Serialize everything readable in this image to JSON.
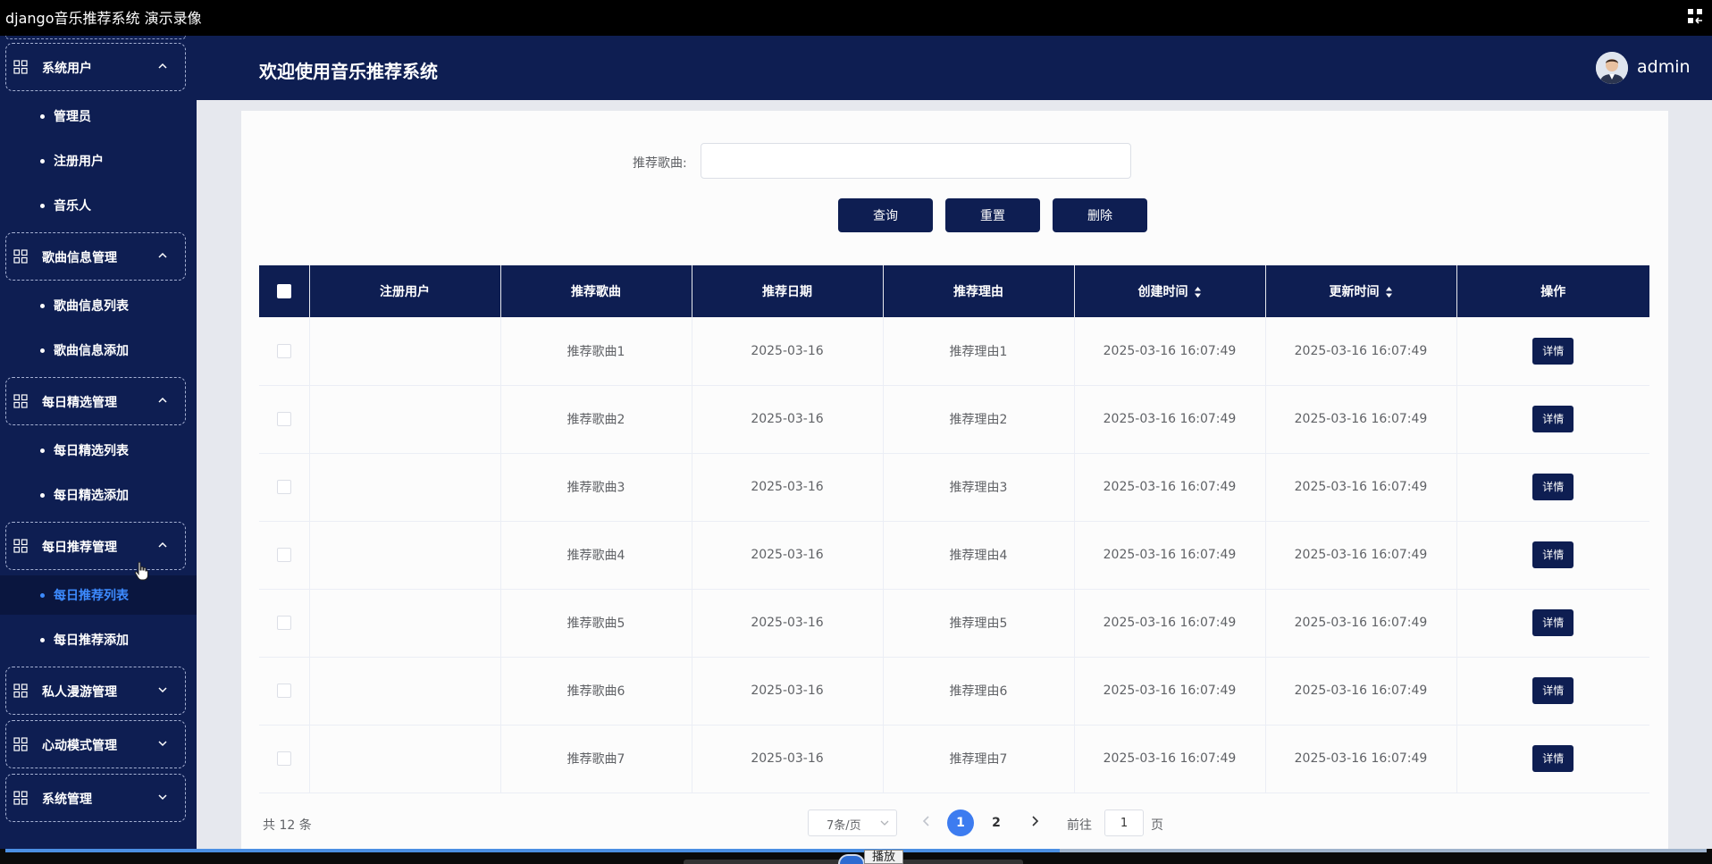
{
  "window": {
    "title": "django音乐推荐系统 演示录像"
  },
  "header": {
    "welcome": "欢迎使用音乐推荐系统",
    "username": "admin"
  },
  "sidebar": {
    "groups": [
      {
        "label": "系统用户",
        "expanded": true,
        "items": [
          "管理员",
          "注册用户",
          "音乐人"
        ]
      },
      {
        "label": "歌曲信息管理",
        "expanded": true,
        "items": [
          "歌曲信息列表",
          "歌曲信息添加"
        ]
      },
      {
        "label": "每日精选管理",
        "expanded": true,
        "items": [
          "每日精选列表",
          "每日精选添加"
        ]
      },
      {
        "label": "每日推荐管理",
        "expanded": true,
        "items": [
          "每日推荐列表",
          "每日推荐添加"
        ]
      },
      {
        "label": "私人漫游管理",
        "expanded": false,
        "items": []
      },
      {
        "label": "心动模式管理",
        "expanded": false,
        "items": []
      },
      {
        "label": "系统管理",
        "expanded": false,
        "items": []
      }
    ],
    "active_item": "每日推荐列表"
  },
  "search": {
    "label": "推荐歌曲:",
    "value": ""
  },
  "buttons": {
    "query": "查询",
    "reset": "重置",
    "delete": "删除"
  },
  "table": {
    "columns": [
      "注册用户",
      "推荐歌曲",
      "推荐日期",
      "推荐理由",
      "创建时间",
      "更新时间",
      "操作"
    ],
    "rows": [
      {
        "user": "",
        "song": "推荐歌曲1",
        "date": "2025-03-16",
        "reason": "推荐理由1",
        "created": "2025-03-16 16:07:49",
        "updated": "2025-03-16 16:07:49"
      },
      {
        "user": "",
        "song": "推荐歌曲2",
        "date": "2025-03-16",
        "reason": "推荐理由2",
        "created": "2025-03-16 16:07:49",
        "updated": "2025-03-16 16:07:49"
      },
      {
        "user": "",
        "song": "推荐歌曲3",
        "date": "2025-03-16",
        "reason": "推荐理由3",
        "created": "2025-03-16 16:07:49",
        "updated": "2025-03-16 16:07:49"
      },
      {
        "user": "",
        "song": "推荐歌曲4",
        "date": "2025-03-16",
        "reason": "推荐理由4",
        "created": "2025-03-16 16:07:49",
        "updated": "2025-03-16 16:07:49"
      },
      {
        "user": "",
        "song": "推荐歌曲5",
        "date": "2025-03-16",
        "reason": "推荐理由5",
        "created": "2025-03-16 16:07:49",
        "updated": "2025-03-16 16:07:49"
      },
      {
        "user": "",
        "song": "推荐歌曲6",
        "date": "2025-03-16",
        "reason": "推荐理由6",
        "created": "2025-03-16 16:07:49",
        "updated": "2025-03-16 16:07:49"
      },
      {
        "user": "",
        "song": "推荐歌曲7",
        "date": "2025-03-16",
        "reason": "推荐理由7",
        "created": "2025-03-16 16:07:49",
        "updated": "2025-03-16 16:07:49"
      }
    ],
    "detail_label": "详情"
  },
  "pagination": {
    "total_text": "共 12 条",
    "page_size_text": "7条/页",
    "pages": [
      "1",
      "2"
    ],
    "current_page": "1",
    "goto_label": "前往",
    "goto_value": "1",
    "goto_unit": "页"
  },
  "playback": {
    "tooltip": "播放",
    "progress": 0.62
  },
  "colors": {
    "navy": "#0e1e52",
    "accent_blue": "#3d8bff",
    "page_current": "#3d7cf0"
  }
}
